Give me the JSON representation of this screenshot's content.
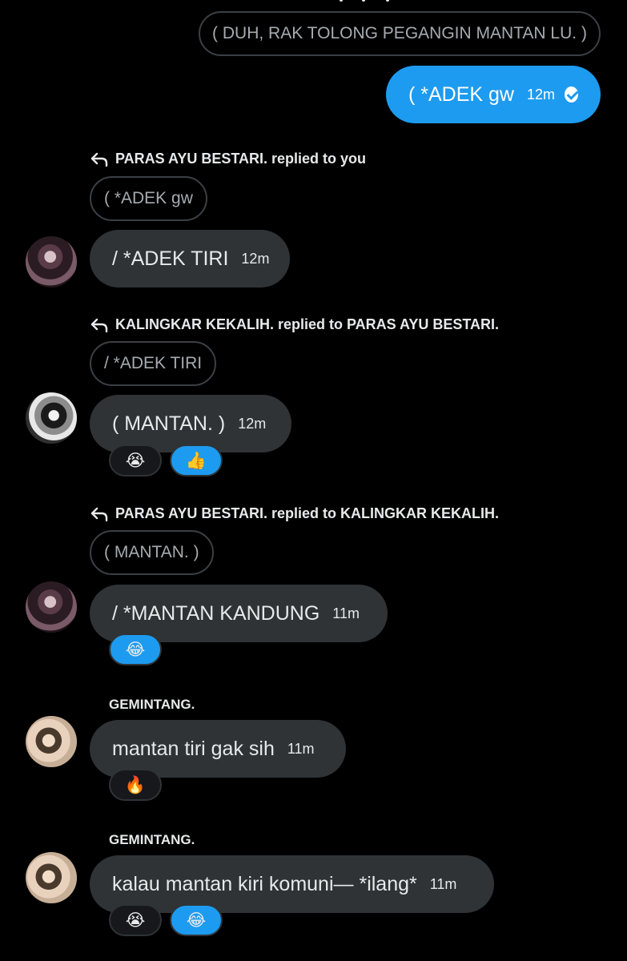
{
  "colors": {
    "background": "#000000",
    "bubble_in": "#2f3336",
    "bubble_out": "#1d9bf0",
    "text": "#e7e9ea",
    "muted": "#a6abb0"
  },
  "top_quote": "( DUH, RAK TOLONG PEGANGIN MANTAN LU. )",
  "messages": [
    {
      "text": "( *ADEK gw",
      "time": "12m",
      "icon": "check-circle-icon"
    },
    {
      "reply_context": "PARAS AYU BESTARI. replied to you",
      "quote": "( *ADEK gw",
      "text": "/ *ADEK TIRI",
      "time": "12m"
    },
    {
      "reply_context": "KALINGKAR KEKALIH. replied to PARAS AYU BESTARI.",
      "quote": "/ *ADEK TIRI",
      "text": "( MANTAN. )",
      "time": "12m",
      "reactions": [
        "😭",
        "👍"
      ]
    },
    {
      "reply_context": "PARAS AYU BESTARI. replied to KALINGKAR KEKALIH.",
      "quote": "( MANTAN. )",
      "text": "/ *MANTAN KANDUNG",
      "time": "11m",
      "reactions": [
        "😂"
      ]
    },
    {
      "sender": "GEMINTANG.",
      "text": "mantan tiri gak sih",
      "time": "11m",
      "reactions": [
        "🔥"
      ]
    },
    {
      "sender": "GEMINTANG.",
      "text": "kalau mantan kiri komuni— *ilang*",
      "time": "11m",
      "reactions": [
        "😭",
        "😂"
      ]
    }
  ]
}
